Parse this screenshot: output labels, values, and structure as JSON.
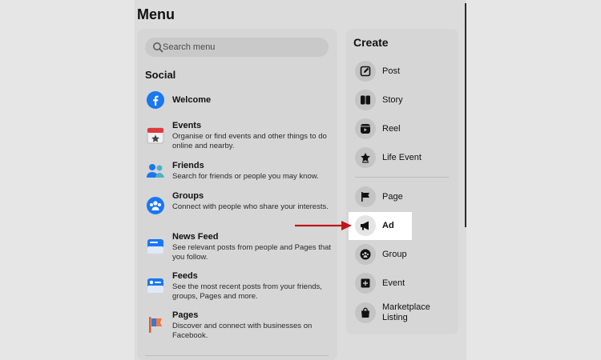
{
  "menu": {
    "title": "Menu"
  },
  "search": {
    "placeholder": "Search menu"
  },
  "social": {
    "title": "Social",
    "items": [
      {
        "name": "Welcome",
        "desc": "",
        "icon": "facebook-icon"
      },
      {
        "name": "Events",
        "desc": "Organise or find events and other things to do online and nearby.",
        "icon": "calendar-icon"
      },
      {
        "name": "Friends",
        "desc": "Search for friends or people you may know.",
        "icon": "friends-icon"
      },
      {
        "name": "Groups",
        "desc": "Connect with people who share your interests.",
        "icon": "groups-icon"
      },
      {
        "name": "News Feed",
        "desc": "See relevant posts from people and Pages that you follow.",
        "icon": "news-feed-icon"
      },
      {
        "name": "Feeds",
        "desc": "See the most recent posts from your friends, groups, Pages and more.",
        "icon": "feeds-icon"
      },
      {
        "name": "Pages",
        "desc": "Discover and connect with businesses on Facebook.",
        "icon": "pages-flag-icon"
      }
    ]
  },
  "create": {
    "title": "Create",
    "items": [
      {
        "label": "Post",
        "icon": "edit-icon"
      },
      {
        "label": "Story",
        "icon": "book-icon"
      },
      {
        "label": "Reel",
        "icon": "reel-icon"
      },
      {
        "label": "Life Event",
        "icon": "star-icon"
      },
      {
        "label": "Page",
        "icon": "flag-icon"
      },
      {
        "label": "Ad",
        "icon": "megaphone-icon"
      },
      {
        "label": "Group",
        "icon": "group-icon"
      },
      {
        "label": "Event",
        "icon": "event-icon"
      },
      {
        "label": "Marketplace Listing",
        "icon": "shopping-bag-icon"
      }
    ]
  },
  "colors": {
    "accent": "#1877f2",
    "arrow": "#c0161a",
    "highlight": "#ffffff"
  }
}
